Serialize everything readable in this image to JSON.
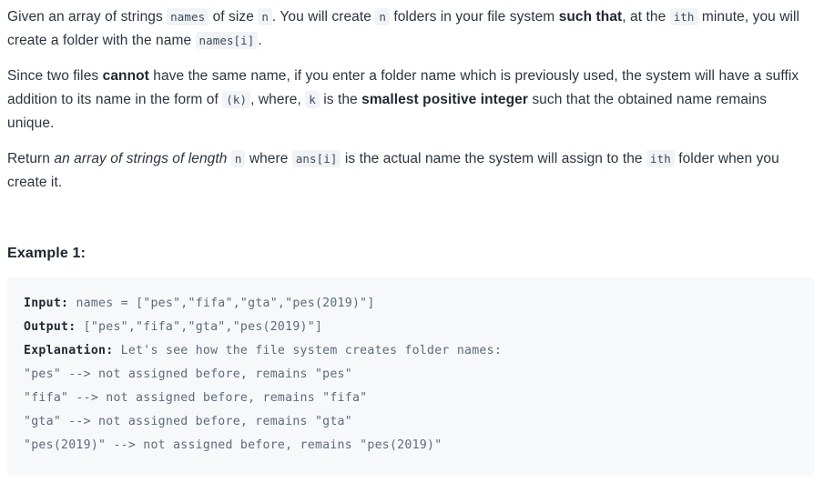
{
  "problem": {
    "paragraphs": [
      {
        "id": "p1",
        "segments": [
          {
            "type": "text",
            "text": "Given an array of strings "
          },
          {
            "type": "code",
            "text": "names"
          },
          {
            "type": "text",
            "text": " of size "
          },
          {
            "type": "code",
            "text": "n"
          },
          {
            "type": "text",
            "text": ". You will create "
          },
          {
            "type": "code",
            "text": "n"
          },
          {
            "type": "text",
            "text": " folders in your file system "
          },
          {
            "type": "bold",
            "text": "such that"
          },
          {
            "type": "text",
            "text": ", at the "
          },
          {
            "type": "code",
            "text": "ith"
          },
          {
            "type": "text",
            "text": " minute, you will create a folder with the name "
          },
          {
            "type": "code",
            "text": "names[i]"
          },
          {
            "type": "text",
            "text": "."
          }
        ]
      },
      {
        "id": "p2",
        "segments": [
          {
            "type": "text",
            "text": "Since two files "
          },
          {
            "type": "bold",
            "text": "cannot"
          },
          {
            "type": "text",
            "text": " have the same name, if you enter a folder name which is previously used, the system will have a suffix addition to its name in the form of "
          },
          {
            "type": "code",
            "text": "(k)"
          },
          {
            "type": "text",
            "text": ", where, "
          },
          {
            "type": "code",
            "text": "k"
          },
          {
            "type": "text",
            "text": " is the "
          },
          {
            "type": "bold",
            "text": "smallest positive integer"
          },
          {
            "type": "text",
            "text": " such that the obtained name remains unique."
          }
        ]
      },
      {
        "id": "p3",
        "segments": [
          {
            "type": "text",
            "text": "Return "
          },
          {
            "type": "italic",
            "text": "an array of strings of length"
          },
          {
            "type": "text",
            "text": " "
          },
          {
            "type": "code",
            "text": "n"
          },
          {
            "type": "text",
            "text": " where "
          },
          {
            "type": "code",
            "text": "ans[i]"
          },
          {
            "type": "text",
            "text": " is the actual name the system will assign to the "
          },
          {
            "type": "code",
            "text": "ith"
          },
          {
            "type": "text",
            "text": " folder when you create it."
          }
        ]
      }
    ]
  },
  "example": {
    "heading": "Example 1:",
    "lines": [
      {
        "label": "Input:",
        "rest": " names = [\"pes\",\"fifa\",\"gta\",\"pes(2019)\"]"
      },
      {
        "label": "Output:",
        "rest": " [\"pes\",\"fifa\",\"gta\",\"pes(2019)\"]"
      },
      {
        "label": "Explanation:",
        "rest": " Let's see how the file system creates folder names:"
      },
      {
        "label": "",
        "rest": "\"pes\" --> not assigned before, remains \"pes\""
      },
      {
        "label": "",
        "rest": "\"fifa\" --> not assigned before, remains \"fifa\""
      },
      {
        "label": "",
        "rest": "\"gta\" --> not assigned before, remains \"gta\""
      },
      {
        "label": "",
        "rest": "\"pes(2019)\" --> not assigned before, remains \"pes(2019)\""
      }
    ]
  },
  "theme": {
    "page_background": "#ffffff",
    "text_color": "#2b3440",
    "code_block_background": "#f7f8fa",
    "inline_code_background": "#f2f3f6",
    "code_text_color": "#5b6b7c",
    "heading_color": "#1c2430"
  }
}
